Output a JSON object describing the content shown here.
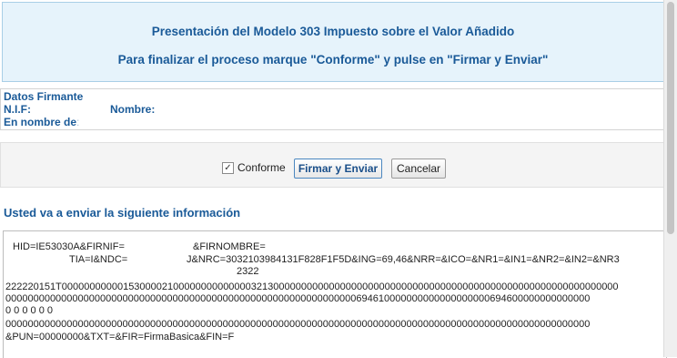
{
  "header": {
    "title": "Presentación del Modelo 303 Impuesto sobre el Valor Añadido",
    "instruction": "Para finalizar el proceso marque \"Conforme\" y pulse en \"Firmar y Enviar\""
  },
  "signer": {
    "section_label": "Datos Firmante",
    "nif_label": "N.I.F:",
    "name_label": "Nombre:",
    "on_behalf_label": "En nombre de",
    "on_behalf_colon": ":"
  },
  "actions": {
    "conforme_checked": true,
    "conforme_label": "Conforme",
    "sign_send_label": "Firmar y Enviar",
    "cancel_label": "Cancelar"
  },
  "info": {
    "title": "Usted va a enviar la siguiente información",
    "lines": [
      "HID=IE53030A&FIRNIF=",
      "&FIRNOMBRE=",
      "TIA=I&NDC=",
      "J&NRC=3032103984131F828F1F5D&ING=69,46&NRR=&ICO=&NR1=&IN1=&NR2=&IN2=&NR3",
      "2322",
      "222220151T0000000000015300002100000000000000321300000000000000000000000000000000000000000000000000000000000000",
      "000000000000000000000000000000000000000000000000000000000000000694610000000000000000000694600000000000000",
      "0 0 0 0 0 0",
      "000000000000000000000000000000000000000000000000000000000000000000000000000000000000000000000000000000000",
      "&PUN=00000000&TXT=&FIR=FirmaBasica&FIN=F"
    ]
  }
}
